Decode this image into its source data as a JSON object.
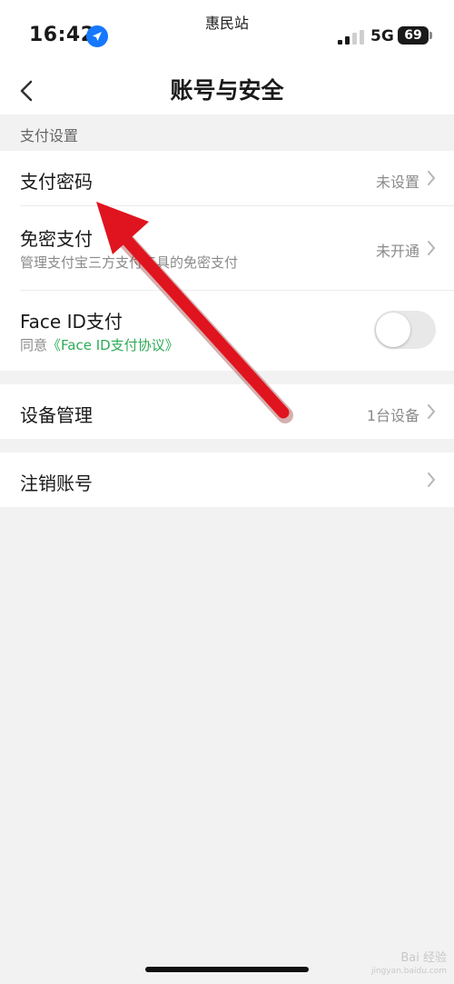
{
  "status_bar": {
    "time": "16:42",
    "carrier": "惠民站",
    "network": "5G",
    "battery": "69",
    "location_icon": "location-arrow-icon",
    "signal_icon": "signal-bars-icon"
  },
  "nav": {
    "title": "账号与安全",
    "back_icon": "chevron-left-icon"
  },
  "section_payment": {
    "header": "支付设置",
    "items": [
      {
        "title": "支付密码",
        "value": "未设置"
      },
      {
        "title": "免密支付",
        "subtitle": "管理支付宝三方支付工具的免密支付",
        "value": "未开通"
      },
      {
        "title": "Face ID支付",
        "subtitle_prefix": "同意",
        "subtitle_link": "《Face ID支付协议》",
        "toggle_on": false
      }
    ]
  },
  "device": {
    "title": "设备管理",
    "value": "1台设备"
  },
  "logout": {
    "title": "注销账号"
  },
  "watermark": {
    "line1": "Bai 经验",
    "line2": "jingyan.baidu.com"
  },
  "colors": {
    "background": "#f2f2f2",
    "card": "#ffffff",
    "link_green": "#2eab57",
    "annotation_red": "#e0141e",
    "location_blue": "#1677ff"
  }
}
